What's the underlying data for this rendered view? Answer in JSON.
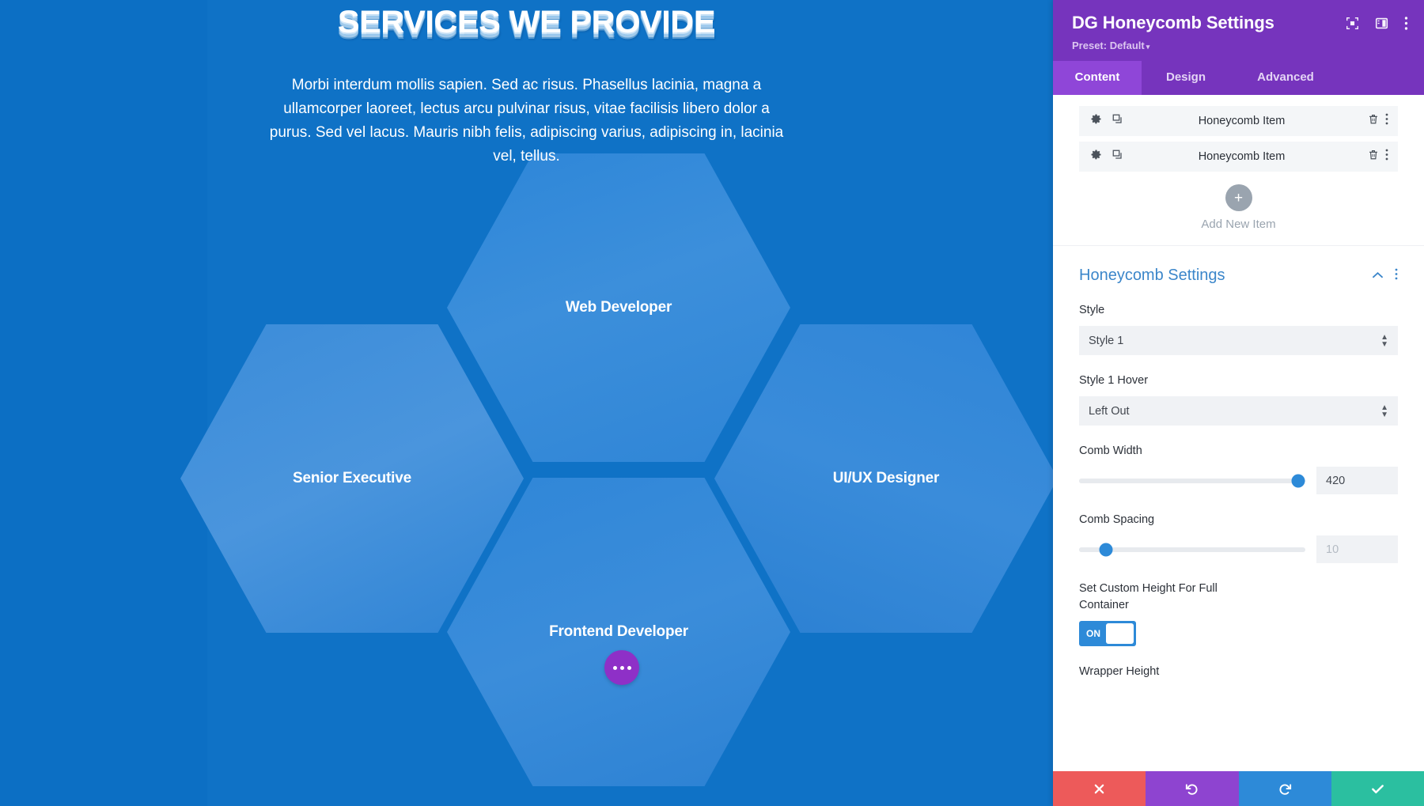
{
  "canvas": {
    "background_color": "#0c6fc4",
    "hero": {
      "title": "SERVICES WE PROVIDE",
      "paragraph": "Morbi interdum mollis sapien. Sed ac risus. Phasellus lacinia, magna a ullamcorper laoreet, lectus arcu pulvinar risus, vitae facilisis libero dolor a purus. Sed vel lacus. Mauris nibh felis, adipiscing varius, adipiscing in, lacinia vel, tellus."
    },
    "honeycomb": {
      "items": [
        {
          "label": "Web Developer"
        },
        {
          "label": "Senior Executive"
        },
        {
          "label": "UI/UX Designer"
        },
        {
          "label": "Frontend Developer"
        }
      ]
    },
    "floating_button": {
      "icon": "ellipsis-icon",
      "color": "#8e30c7"
    }
  },
  "panel": {
    "title": "DG Honeycomb Settings",
    "preset_label": "Preset: Default",
    "preset_caret": "▾",
    "header_icons": [
      {
        "name": "focus-target-icon"
      },
      {
        "name": "panel-layout-icon"
      },
      {
        "name": "kebab-menu-icon"
      }
    ],
    "tabs": [
      {
        "label": "Content",
        "active": true
      },
      {
        "label": "Design",
        "active": false
      },
      {
        "label": "Advanced",
        "active": false
      }
    ],
    "items": [
      {
        "title": "Honeycomb Item"
      },
      {
        "title": "Honeycomb Item"
      }
    ],
    "add_new": {
      "label": "Add New Item",
      "icon": "plus-icon"
    },
    "section": {
      "title": "Honeycomb Settings",
      "collapse_icon": "chevron-up-icon",
      "menu_icon": "kebab-menu-icon",
      "fields": {
        "style": {
          "label": "Style",
          "value": "Style 1"
        },
        "style_hover": {
          "label": "Style 1 Hover",
          "value": "Left Out"
        },
        "comb_width": {
          "label": "Comb Width",
          "value": "420",
          "percent": 97
        },
        "comb_spacing": {
          "label": "Comb Spacing",
          "placeholder": "10",
          "percent": 12
        },
        "custom_height": {
          "label": "Set Custom Height For Full Container",
          "toggle_state": "ON"
        },
        "wrapper_height": {
          "label": "Wrapper Height"
        }
      }
    },
    "footer": [
      {
        "name": "cancel-button",
        "icon": "close-icon",
        "color": "#ed5a5a"
      },
      {
        "name": "undo-button",
        "icon": "undo-icon",
        "color": "#8e44d0"
      },
      {
        "name": "redo-button",
        "icon": "redo-icon",
        "color": "#2d8ad8"
      },
      {
        "name": "save-button",
        "icon": "check-icon",
        "color": "#2bbfa0"
      }
    ]
  }
}
